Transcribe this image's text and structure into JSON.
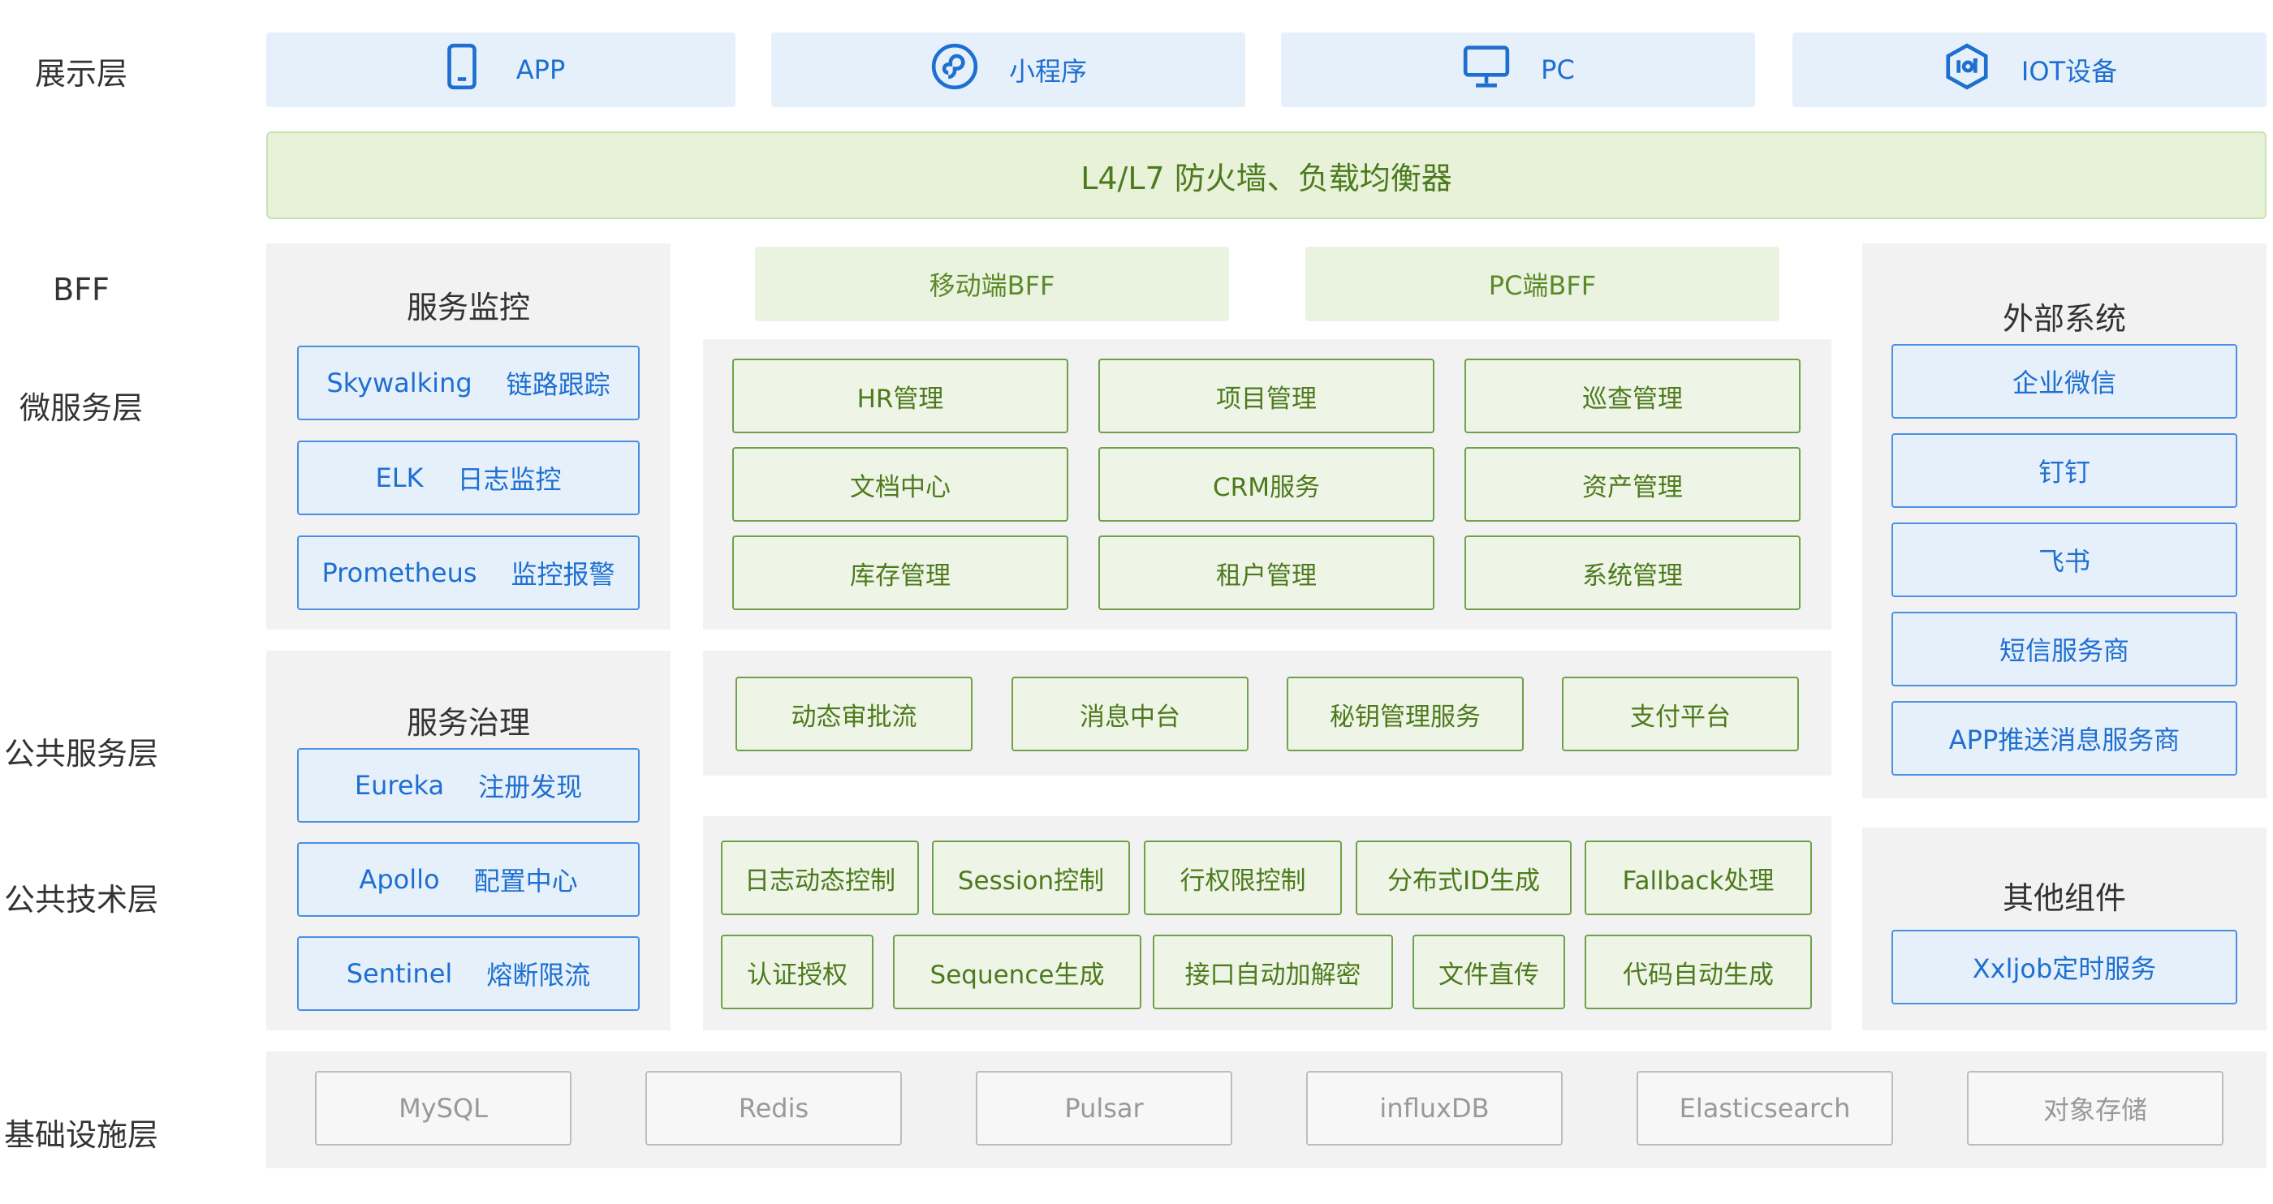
{
  "layers": {
    "presentation": "展示层",
    "bff": "BFF",
    "microservice": "微服务层",
    "common_service": "公共服务层",
    "common_tech": "公共技术层",
    "infrastructure": "基础设施层"
  },
  "clients": [
    {
      "label": "APP",
      "icon": "mobile-phone-icon"
    },
    {
      "label": "小程序",
      "icon": "mini-program-icon"
    },
    {
      "label": "PC",
      "icon": "monitor-icon"
    },
    {
      "label": "IOT设备",
      "icon": "iot-device-icon"
    }
  ],
  "gateway": "L4/L7 防火墙、负载均衡器",
  "monitoring": {
    "title": "服务监控",
    "items": [
      {
        "name": "Skywalking",
        "desc": "链路跟踪"
      },
      {
        "name": "ELK",
        "desc": "日志监控"
      },
      {
        "name": "Prometheus",
        "desc": "监控报警"
      }
    ]
  },
  "governance": {
    "title": "服务治理",
    "items": [
      {
        "name": "Eureka",
        "desc": "注册发现"
      },
      {
        "name": "Apollo",
        "desc": "配置中心"
      },
      {
        "name": "Sentinel",
        "desc": "熔断限流"
      }
    ]
  },
  "bff": [
    "移动端BFF",
    "PC端BFF"
  ],
  "microservices": [
    "HR管理",
    "项目管理",
    "巡查管理",
    "文档中心",
    "CRM服务",
    "资产管理",
    "库存管理",
    "租户管理",
    "系统管理"
  ],
  "common_services": [
    "动态审批流",
    "消息中台",
    "秘钥管理服务",
    "支付平台"
  ],
  "common_tech": [
    "日志动态控制",
    "Session控制",
    "行权限控制",
    "分布式ID生成",
    "Fallback处理",
    "认证授权",
    "Sequence生成",
    "接口自动加解密",
    "文件直传",
    "代码自动生成"
  ],
  "external": {
    "title": "外部系统",
    "items": [
      "企业微信",
      "钉钉",
      "飞书",
      "短信服务商",
      "APP推送消息服务商"
    ]
  },
  "other": {
    "title": "其他组件",
    "items": [
      "Xxljob定时服务"
    ]
  },
  "infra": [
    "MySQL",
    "Redis",
    "Pulsar",
    "influxDB",
    "Elasticsearch",
    "对象存储"
  ]
}
